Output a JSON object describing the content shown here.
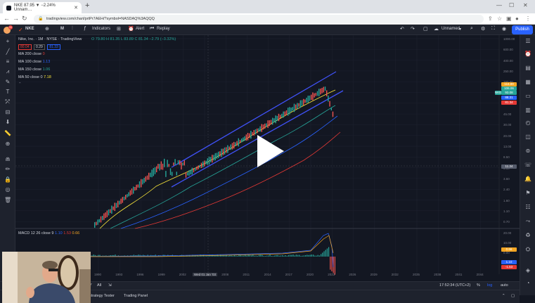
{
  "browser": {
    "tab_title": "NKE 87.95 ▼ −2.24% Unnam…",
    "url": "tradingview.com/chart/prtPr7AEH/?symbol=NASDAQ%3AQQQ"
  },
  "toolbar": {
    "symbol": "NKE",
    "interval": "M",
    "indicators_label": "Indicators",
    "alert_label": "Alert",
    "replay_label": "Replay",
    "layout_name": "Unnamed",
    "publish_label": "Publish",
    "avatar_badge": "11"
  },
  "legend": {
    "title": "Nike, Inc.",
    "interval": "1M",
    "exchange": "NYSE",
    "source": "TradingView",
    "ohlc": "O 79.80  H 81.35  L 83.89  C 81.34  −2.79 (−3.32%)",
    "price_box_1": "80.04",
    "price_box_2": "0.29",
    "price_box_3": "81.33",
    "ma_lines": [
      {
        "label": "MA 200 close",
        "value": "0",
        "color": "#e53935"
      },
      {
        "label": "MA 100 close",
        "value": "1.13",
        "color": "#2962ff"
      },
      {
        "label": "MA 150 close",
        "value": "1.06",
        "color": "#26a69a"
      },
      {
        "label": "MA 50 close 0",
        "value": "7.18",
        "color": "#ffeb3b"
      }
    ]
  },
  "macd": {
    "label": "MACD 12 26 close 9",
    "v1": "1.10",
    "v2": "1.53",
    "v3": "0.66"
  },
  "price_axis": [
    "1000.00",
    "600.00",
    "400.00",
    "250.00",
    "160.00",
    "100.00",
    "70.00",
    "45.00",
    "30.00",
    "20.00",
    "13.00",
    "8.50",
    "5.60",
    "3.60",
    "2.40",
    "1.60",
    "1.10",
    "0.70"
  ],
  "price_badges": [
    {
      "text": "116.89",
      "color": "#f5a623"
    },
    {
      "text": "106.06",
      "color": "#26a69a"
    },
    {
      "text": "93.08",
      "color": "#26a69a"
    },
    {
      "text": "88.31",
      "color": "#2962ff"
    },
    {
      "text": "81.34",
      "color": "#e53935"
    },
    {
      "text": "11.24",
      "color": "#555b6b"
    }
  ],
  "nke_tag": "NKE",
  "macd_axis": [
    "20.00",
    "10.00",
    "0.00",
    "-10.00"
  ],
  "macd_badges": [
    {
      "text": "0.66",
      "color": "#f5a623"
    },
    {
      "text": "1.10",
      "color": "#2962ff"
    },
    {
      "text": "-1.53",
      "color": "#e53935"
    }
  ],
  "time_axis": [
    "1990",
    "1993",
    "1996",
    "1999",
    "2002",
    "2005",
    "2008",
    "2011",
    "2014",
    "2017",
    "2020",
    "2023",
    "2026",
    "2029",
    "2032",
    "2035",
    "2038",
    "2041",
    "2044"
  ],
  "crosshair_date": "Wed 01 Jan '03",
  "bottom": {
    "range_label": "5Y",
    "all_label": "All",
    "clock": "17:52:34 (UTC+2)",
    "pct": "%",
    "log": "log",
    "auto": "auto"
  },
  "panels": {
    "strategy_tester": "Strategy Tester",
    "trading_panel": "Trading Panel"
  },
  "play_button": "play-icon"
}
